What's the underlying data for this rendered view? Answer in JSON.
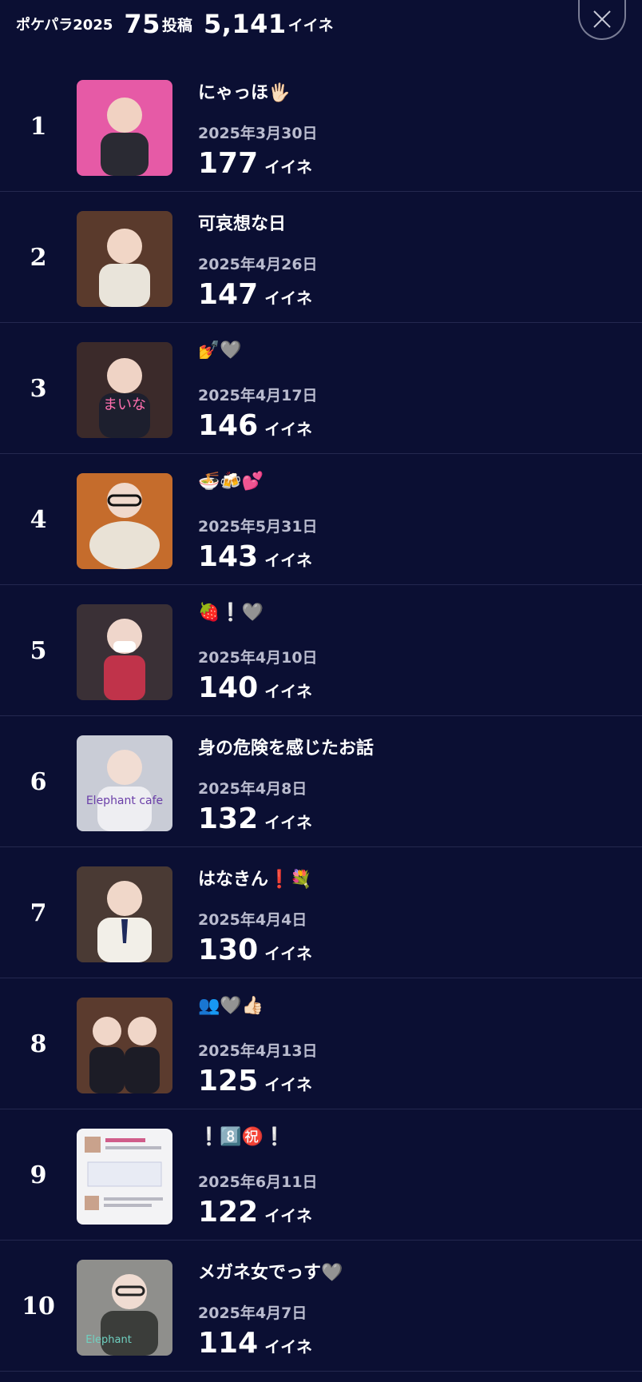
{
  "header": {
    "title": "ポケパラ2025",
    "posts_count": "75",
    "posts_label": "投稿",
    "likes_total": "5,141",
    "likes_label": "イイネ",
    "close_icon": "close-icon"
  },
  "posts": [
    {
      "rank": "1",
      "title": "にゃっほ🖐🏻",
      "date": "2025年3月30日",
      "likes": "177",
      "likes_label": "イイネ",
      "thumb_color": "#e65aa6"
    },
    {
      "rank": "2",
      "title": "可哀想な日",
      "date": "2025年4月26日",
      "likes": "147",
      "likes_label": "イイネ",
      "thumb_color": "#5a3a2c"
    },
    {
      "rank": "3",
      "title": "💅🩶",
      "date": "2025年4月17日",
      "likes": "146",
      "likes_label": "イイネ",
      "thumb_color": "#3b2a2a"
    },
    {
      "rank": "4",
      "title": "🍜🍻💕",
      "date": "2025年5月31日",
      "likes": "143",
      "likes_label": "イイネ",
      "thumb_color": "#c56c2c"
    },
    {
      "rank": "5",
      "title": "🍓❕🩶",
      "date": "2025年4月10日",
      "likes": "140",
      "likes_label": "イイネ",
      "thumb_color": "#3a3036"
    },
    {
      "rank": "6",
      "title": "身の危険を感じたお話",
      "date": "2025年4月8日",
      "likes": "132",
      "likes_label": "イイネ",
      "thumb_color": "#c9ccd6"
    },
    {
      "rank": "7",
      "title": "はなきん❗️💐",
      "date": "2025年4月4日",
      "likes": "130",
      "likes_label": "イイネ",
      "thumb_color": "#4a3a34"
    },
    {
      "rank": "8",
      "title": "👥🩶👍🏻",
      "date": "2025年4月13日",
      "likes": "125",
      "likes_label": "イイネ",
      "thumb_color": "#5b3b2e"
    },
    {
      "rank": "9",
      "title": "❕8️⃣㊗️❕",
      "date": "2025年6月11日",
      "likes": "122",
      "likes_label": "イイネ",
      "thumb_color": "#f3f3f5"
    },
    {
      "rank": "10",
      "title": "メガネ女でっす🩶",
      "date": "2025年4月7日",
      "likes": "114",
      "likes_label": "イイネ",
      "thumb_color": "#8f8f8c"
    }
  ]
}
